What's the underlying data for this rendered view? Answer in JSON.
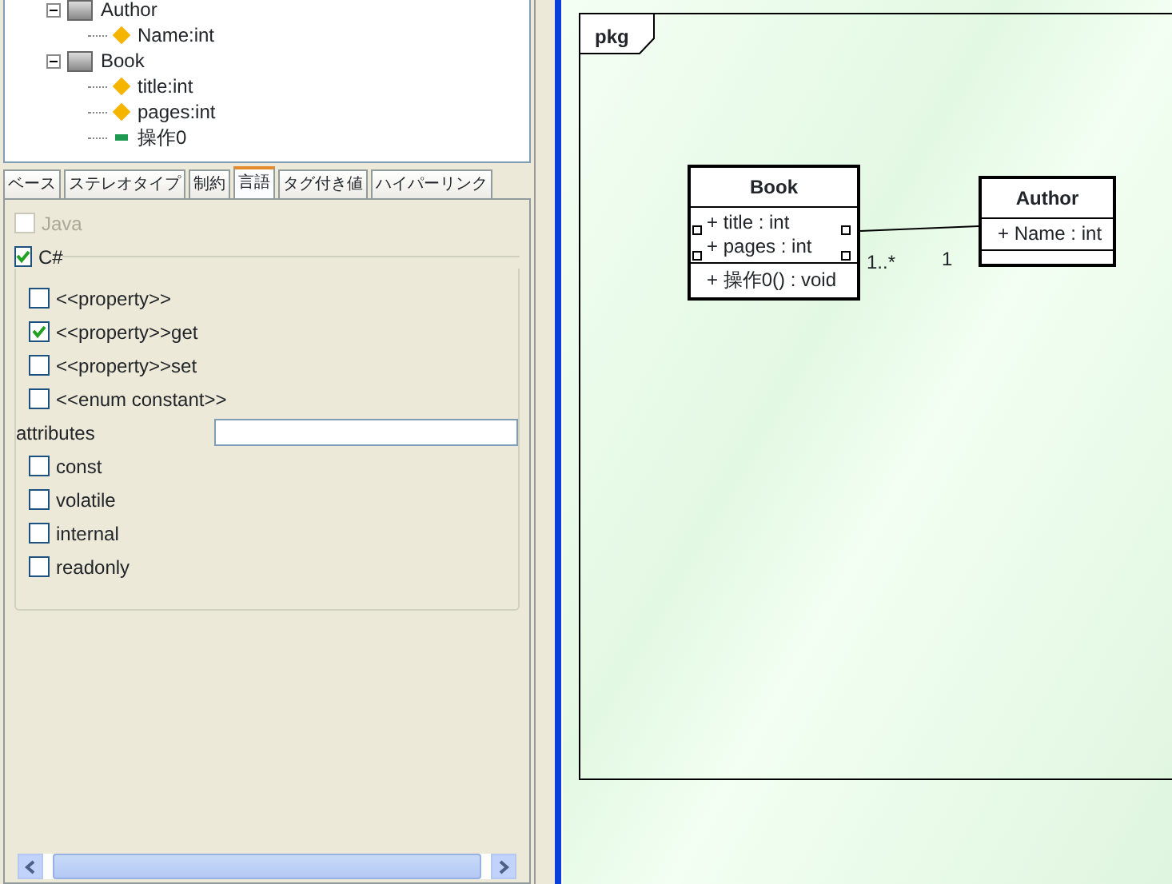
{
  "tree": [
    {
      "label": "Author",
      "kind": "class",
      "expanded": true,
      "children": [
        {
          "label": "Name:int",
          "kind": "attribute"
        }
      ]
    },
    {
      "label": "Book",
      "kind": "class",
      "expanded": true,
      "children": [
        {
          "label": "title:int",
          "kind": "attribute"
        },
        {
          "label": "pages:int",
          "kind": "attribute"
        },
        {
          "label": "操作0",
          "kind": "operation"
        }
      ]
    }
  ],
  "tabs": [
    {
      "label": "ベース",
      "selected": false
    },
    {
      "label": "ステレオタイプ",
      "selected": false
    },
    {
      "label": "制約",
      "selected": false
    },
    {
      "label": "言語",
      "selected": true
    },
    {
      "label": "タグ付き値",
      "selected": false
    },
    {
      "label": "ハイパーリンク",
      "selected": false
    }
  ],
  "languages": [
    {
      "label": "Java",
      "checked": false,
      "disabled": true
    },
    {
      "label": "C#",
      "checked": true,
      "disabled": false
    }
  ],
  "stereotypes": [
    {
      "label": "<<property>>",
      "checked": false
    },
    {
      "label": "<<property>>get",
      "checked": true
    },
    {
      "label": "<<property>>set",
      "checked": false
    },
    {
      "label": "<<enum constant>>",
      "checked": false
    }
  ],
  "attributes_label": "attributes",
  "modifiers": [
    {
      "label": "const",
      "checked": false
    },
    {
      "label": "volatile",
      "checked": false
    },
    {
      "label": "internal",
      "checked": false
    },
    {
      "label": "readonly",
      "checked": false
    }
  ],
  "diagram": {
    "frame_label": "pkg",
    "classes": [
      {
        "name": "Book",
        "selected": true,
        "attributes": [
          "+ title : int",
          "+ pages : int"
        ],
        "operations": [
          "+ 操作0() : void"
        ]
      },
      {
        "name": "Author",
        "selected": false,
        "attributes": [
          "+ Name : int"
        ]
      }
    ],
    "association": {
      "source_multiplicity": "1..*",
      "target_multiplicity": "1"
    }
  }
}
